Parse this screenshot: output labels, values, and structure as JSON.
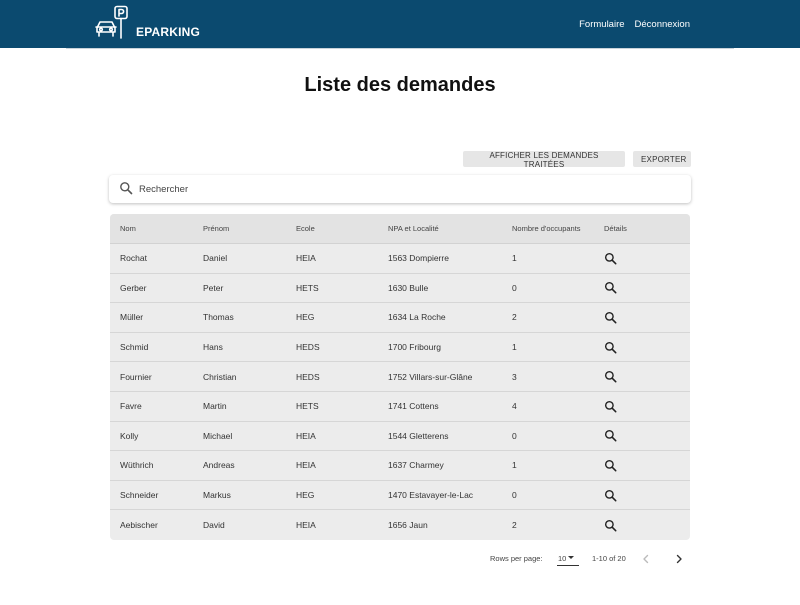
{
  "header": {
    "brand": "EPARKING",
    "nav": [
      "Formulaire",
      "Déconnexion"
    ],
    "color": "#0b4a6f"
  },
  "page": {
    "title": "Liste des demandes"
  },
  "actions": {
    "show_processed": "AFFICHER LES DEMANDES TRAITÉES",
    "export": "EXPORTER"
  },
  "search": {
    "placeholder": "Rechercher",
    "value": ""
  },
  "table": {
    "columns": [
      "Nom",
      "Prénom",
      "Ecole",
      "NPA et Localité",
      "Nombre d'occupants",
      "Détails"
    ],
    "rows": [
      [
        "Rochat",
        "Daniel",
        "HEIA",
        "1563 Dompierre",
        "1"
      ],
      [
        "Gerber",
        "Peter",
        "HETS",
        "1630 Bulle",
        "0"
      ],
      [
        "Müller",
        "Thomas",
        "HEG",
        "1634 La Roche",
        "2"
      ],
      [
        "Schmid",
        "Hans",
        "HEDS",
        "1700 Fribourg",
        "1"
      ],
      [
        "Fournier",
        "Christian",
        "HEDS",
        "1752 Villars-sur-Glâne",
        "3"
      ],
      [
        "Favre",
        "Martin",
        "HETS",
        "1741 Cottens",
        "4"
      ],
      [
        "Kolly",
        "Michael",
        "HEIA",
        "1544 Gletterens",
        "0"
      ],
      [
        "Wüthrich",
        "Andreas",
        "HEIA",
        "1637 Charmey",
        "1"
      ],
      [
        "Schneider",
        "Markus",
        "HEG",
        "1470 Estavayer-le-Lac",
        "0"
      ],
      [
        "Aebischer",
        "David",
        "HEIA",
        "1656 Jaun",
        "2"
      ]
    ],
    "detail_icon": "search-icon"
  },
  "pagination": {
    "rows_per_page_label": "Rows per page:",
    "rows_per_page": "10",
    "range": "1-10 of 20"
  }
}
